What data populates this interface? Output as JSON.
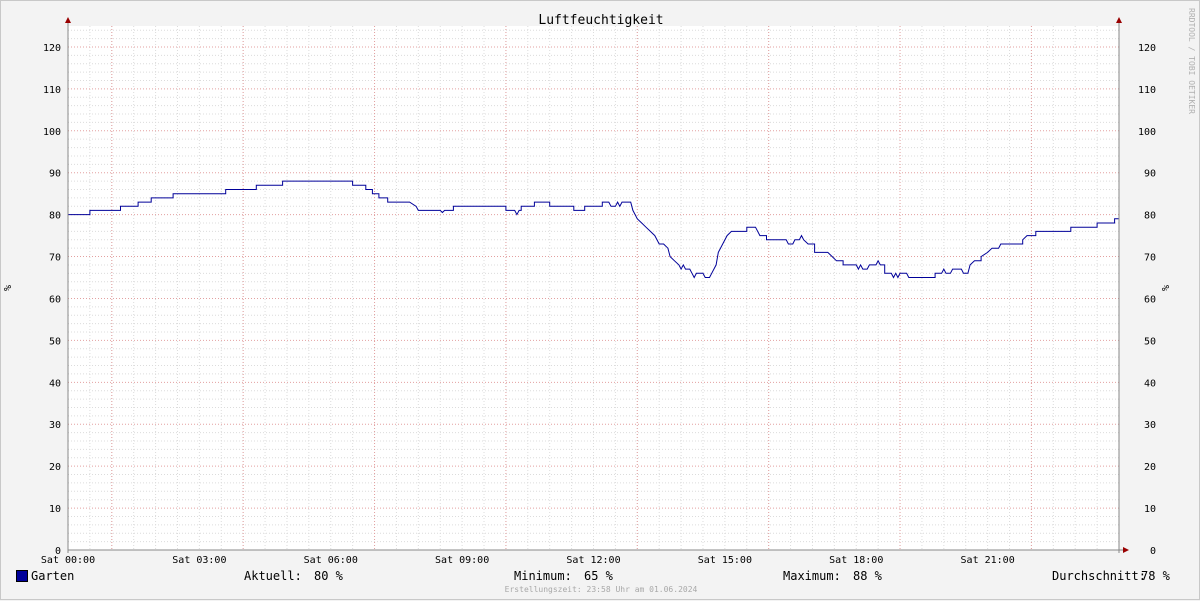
{
  "chart_data": {
    "type": "line",
    "title": "Luftfeuchtigkeit",
    "ylabel": "%",
    "ylim": [
      0,
      125
    ],
    "yticks": [
      0,
      10,
      20,
      30,
      40,
      50,
      60,
      70,
      80,
      90,
      100,
      110,
      120
    ],
    "xlim": [
      0,
      24
    ],
    "x_unit": "hours",
    "x_tick_labels": [
      "Sat 00:00",
      "Sat 03:00",
      "Sat 06:00",
      "Sat 09:00",
      "Sat 12:00",
      "Sat 15:00",
      "Sat 18:00",
      "Sat 21:00"
    ],
    "grid": true,
    "watermark": "RRDTOOL / TOBI OETIKER",
    "series": [
      {
        "name": "Garten",
        "color": "#000099",
        "points": [
          [
            0.0,
            80
          ],
          [
            0.5,
            80
          ],
          [
            0.5,
            81
          ],
          [
            1.2,
            81
          ],
          [
            1.2,
            82
          ],
          [
            1.6,
            82
          ],
          [
            1.6,
            83
          ],
          [
            1.9,
            83
          ],
          [
            1.9,
            84
          ],
          [
            2.4,
            84
          ],
          [
            2.4,
            85
          ],
          [
            3.6,
            85
          ],
          [
            3.6,
            86
          ],
          [
            4.3,
            86
          ],
          [
            4.3,
            87
          ],
          [
            4.9,
            87
          ],
          [
            4.9,
            88
          ],
          [
            6.5,
            88
          ],
          [
            6.5,
            87
          ],
          [
            6.8,
            87
          ],
          [
            6.8,
            86
          ],
          [
            6.95,
            86
          ],
          [
            6.95,
            85
          ],
          [
            7.1,
            85
          ],
          [
            7.1,
            84
          ],
          [
            7.3,
            84
          ],
          [
            7.3,
            83
          ],
          [
            7.8,
            83
          ],
          [
            7.95,
            82
          ],
          [
            8.0,
            81
          ],
          [
            8.5,
            81
          ],
          [
            8.55,
            80.5
          ],
          [
            8.6,
            81
          ],
          [
            8.8,
            81
          ],
          [
            8.8,
            82
          ],
          [
            10.0,
            82
          ],
          [
            10.0,
            81
          ],
          [
            10.2,
            81
          ],
          [
            10.25,
            80
          ],
          [
            10.3,
            81
          ],
          [
            10.35,
            81
          ],
          [
            10.35,
            82
          ],
          [
            10.65,
            82
          ],
          [
            10.65,
            83
          ],
          [
            11.0,
            83
          ],
          [
            11.0,
            82
          ],
          [
            11.55,
            82
          ],
          [
            11.55,
            81
          ],
          [
            11.8,
            81
          ],
          [
            11.8,
            82
          ],
          [
            12.2,
            82
          ],
          [
            12.2,
            83
          ],
          [
            12.35,
            83
          ],
          [
            12.4,
            82
          ],
          [
            12.5,
            82
          ],
          [
            12.55,
            83
          ],
          [
            12.6,
            82
          ],
          [
            12.65,
            83
          ],
          [
            12.85,
            83
          ],
          [
            12.9,
            81
          ],
          [
            13.0,
            79
          ],
          [
            13.1,
            78
          ],
          [
            13.2,
            77
          ],
          [
            13.3,
            76
          ],
          [
            13.4,
            75
          ],
          [
            13.5,
            73
          ],
          [
            13.6,
            73
          ],
          [
            13.7,
            72
          ],
          [
            13.75,
            70
          ],
          [
            13.85,
            69
          ],
          [
            13.95,
            68
          ],
          [
            14.0,
            67
          ],
          [
            14.05,
            68
          ],
          [
            14.1,
            67
          ],
          [
            14.2,
            67
          ],
          [
            14.25,
            66
          ],
          [
            14.3,
            65
          ],
          [
            14.35,
            66
          ],
          [
            14.5,
            66
          ],
          [
            14.55,
            65
          ],
          [
            14.65,
            65
          ],
          [
            14.7,
            66
          ],
          [
            14.8,
            68
          ],
          [
            14.85,
            71
          ],
          [
            14.95,
            73
          ],
          [
            15.05,
            75
          ],
          [
            15.15,
            76
          ],
          [
            15.5,
            76
          ],
          [
            15.5,
            77
          ],
          [
            15.7,
            77
          ],
          [
            15.8,
            75
          ],
          [
            15.95,
            75
          ],
          [
            15.95,
            74
          ],
          [
            16.4,
            74
          ],
          [
            16.45,
            73
          ],
          [
            16.55,
            73
          ],
          [
            16.6,
            74
          ],
          [
            16.7,
            74
          ],
          [
            16.75,
            75
          ],
          [
            16.8,
            74
          ],
          [
            16.9,
            73
          ],
          [
            17.05,
            73
          ],
          [
            17.05,
            71
          ],
          [
            17.35,
            71
          ],
          [
            17.45,
            70
          ],
          [
            17.55,
            69
          ],
          [
            17.7,
            69
          ],
          [
            17.7,
            68
          ],
          [
            18.0,
            68
          ],
          [
            18.05,
            67
          ],
          [
            18.1,
            68
          ],
          [
            18.15,
            67
          ],
          [
            18.25,
            67
          ],
          [
            18.3,
            68
          ],
          [
            18.45,
            68
          ],
          [
            18.5,
            69
          ],
          [
            18.55,
            68
          ],
          [
            18.65,
            68
          ],
          [
            18.65,
            66
          ],
          [
            18.8,
            66
          ],
          [
            18.85,
            65
          ],
          [
            18.9,
            66
          ],
          [
            18.95,
            65
          ],
          [
            19.0,
            66
          ],
          [
            19.15,
            66
          ],
          [
            19.2,
            65
          ],
          [
            19.8,
            65
          ],
          [
            19.8,
            66
          ],
          [
            19.95,
            66
          ],
          [
            20.0,
            67
          ],
          [
            20.05,
            66
          ],
          [
            20.15,
            66
          ],
          [
            20.2,
            67
          ],
          [
            20.4,
            67
          ],
          [
            20.45,
            66
          ],
          [
            20.55,
            66
          ],
          [
            20.6,
            68
          ],
          [
            20.7,
            69
          ],
          [
            20.85,
            69
          ],
          [
            20.85,
            70
          ],
          [
            21.0,
            71
          ],
          [
            21.1,
            72
          ],
          [
            21.25,
            72
          ],
          [
            21.3,
            73
          ],
          [
            21.8,
            73
          ],
          [
            21.8,
            74
          ],
          [
            21.9,
            75
          ],
          [
            22.1,
            75
          ],
          [
            22.1,
            76
          ],
          [
            22.9,
            76
          ],
          [
            22.9,
            77
          ],
          [
            23.5,
            77
          ],
          [
            23.5,
            78
          ],
          [
            23.9,
            78
          ],
          [
            23.9,
            79
          ],
          [
            24.3,
            79
          ],
          [
            24.3,
            80
          ],
          [
            24.7,
            80
          ]
        ]
      }
    ],
    "legend": {
      "name": "Garten",
      "aktuell_label": "Aktuell:",
      "aktuell_value": "80 %",
      "minimum_label": "Minimum:",
      "minimum_value": "65 %",
      "maximum_label": "Maximum:",
      "maximum_value": "88 %",
      "durchschnitt_label": "Durchschnitt:",
      "durchschnitt_value": "78 %"
    },
    "footer": "Erstellungszeit: 23:58 Uhr am 01.06.2024"
  }
}
